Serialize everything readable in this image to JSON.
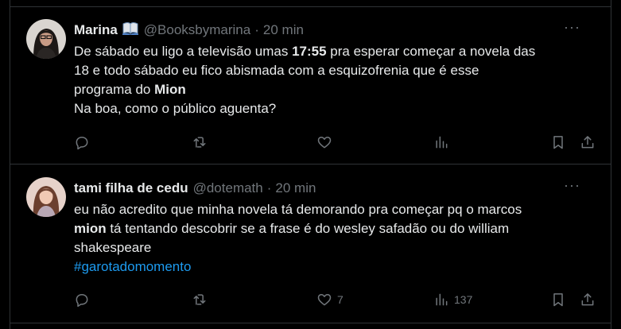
{
  "tweets": [
    {
      "name": "Marina",
      "name_icon": "open-book-icon",
      "handle": "@Booksbymarina",
      "separator": "·",
      "time": "20 min",
      "more": "···",
      "lines": [
        [
          {
            "t": "De sábado eu ligo a televisão umas "
          },
          {
            "t": "17:55",
            "b": true
          },
          {
            "t": " pra esperar começar a novela das"
          }
        ],
        [
          {
            "t": "18 e todo sábado eu fico abismada com a esquizofrenia que é esse"
          }
        ],
        [
          {
            "t": "programa do "
          },
          {
            "t": "Mion",
            "b": true
          }
        ],
        [
          {
            "t": "Na boa, como o público aguenta?"
          }
        ]
      ],
      "likes": "",
      "views": ""
    },
    {
      "name": "tami filha de cedu",
      "name_icon": "",
      "handle": "@dotemath",
      "separator": "·",
      "time": "20 min",
      "more": "···",
      "lines": [
        [
          {
            "t": "eu não acredito que minha novela tá demorando pra começar pq o marcos"
          }
        ],
        [
          {
            "t": "mion",
            "b": true
          },
          {
            "t": " tá tentando descobrir se a frase é do wesley safadão ou do william"
          }
        ],
        [
          {
            "t": "shakespeare"
          }
        ],
        [
          {
            "t": "#garotadomomento",
            "link": true
          }
        ]
      ],
      "likes": "7",
      "views": "137"
    }
  ],
  "colors": {
    "background": "#000000",
    "text": "#e7e9ea",
    "muted": "#71767b",
    "link": "#1d9bf0",
    "border": "#2f3336"
  }
}
